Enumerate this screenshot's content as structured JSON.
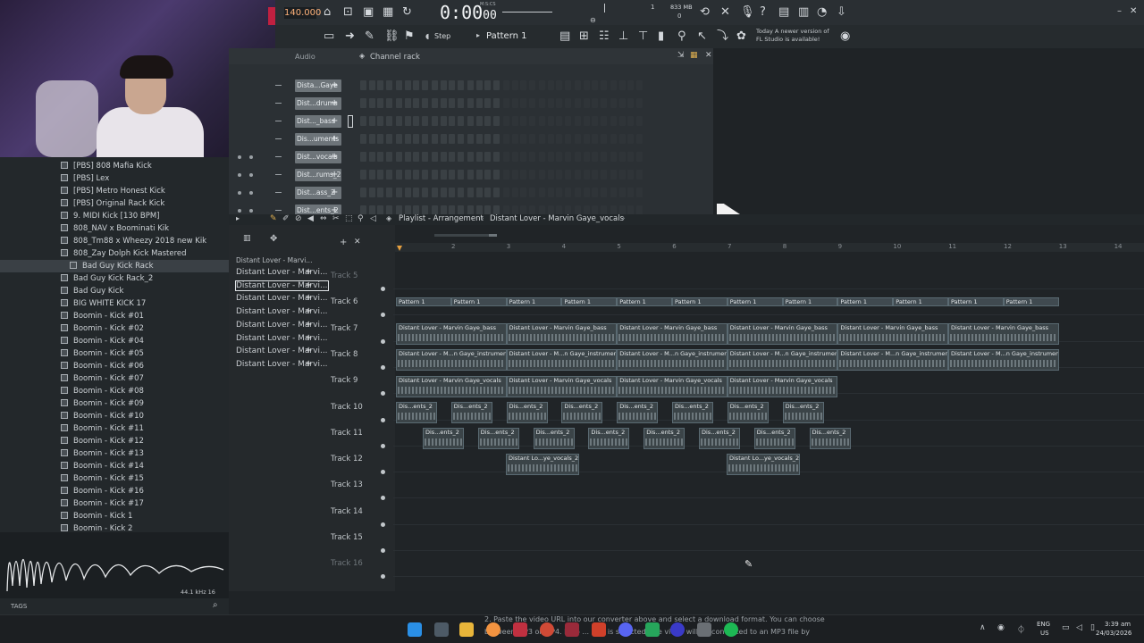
{
  "toolbar": {
    "tempo": "140.000",
    "time": "0:00",
    "time_sub": "00",
    "time_label": "M:S:CS",
    "cpu_label": "1",
    "memory": "833 MB",
    "memory_sub": "0",
    "pattern_name": "Pattern 1",
    "snap_mode": "Step",
    "news_line1": "Today  A newer version of",
    "news_line2": "FL Studio is available!"
  },
  "channel_rack": {
    "title": "Channel rack",
    "group": "Audio",
    "channels": [
      "Dista...Gaye",
      "Dist...drums",
      "Dist..._bass",
      "Dis...uments",
      "Dist...vocals",
      "Dist...rums_2",
      "Dist...ass_2",
      "Dist...ents_2"
    ]
  },
  "browser": {
    "items": [
      "[PBS] 808 Mafia Kick",
      "[PBS] Lex",
      "[PBS] Metro Honest Kick",
      "[PBS] Original Rack Kick",
      "9. MIDI Kick [130 BPM]",
      "808_NAV x Boominati Kik",
      "808_Tm88 x Wheezy 2018 new Kik",
      "808_Zay Dolph Kick Mastered",
      "Bad Guy Kick Rack",
      "Bad Guy Kick Rack_2",
      "Bad Guy Kick",
      "BIG WHITE KICK 17",
      "Boomin - Kick #01",
      "Boomin - Kick #02",
      "Boomin - Kick #04",
      "Boomin - Kick #05",
      "Boomin - Kick #06",
      "Boomin - Kick #07",
      "Boomin - Kick #08",
      "Boomin - Kick #09",
      "Boomin - Kick #10",
      "Boomin - Kick #11",
      "Boomin - Kick #12",
      "Boomin - Kick #13",
      "Boomin - Kick #14",
      "Boomin - Kick #15",
      "Boomin - Kick #16",
      "Boomin - Kick #17",
      "Boomin - Kick 1",
      "Boomin - Kick 2"
    ],
    "selected_index": 8,
    "sample_rate": "44.1 kHz 16",
    "tags_label": "TAGS"
  },
  "playlist": {
    "title": "Playlist - Arrangement",
    "clip_path": "Distant Lover - Marvin Gaye_vocals",
    "picker_header": "Distant Lover - Marvi...",
    "picker_items": [
      "Distant Lover - Marvi...",
      "Distant Lover - Marvi...",
      "Distant Lover - Marvi...",
      "Distant Lover - Marvi...",
      "Distant Lover - Marvi...",
      "Distant Lover - Marvi...",
      "Distant Lover - Marvi...",
      "Distant Lover - Marvi..."
    ],
    "ruler": [
      "2",
      "3",
      "4",
      "5",
      "6",
      "7",
      "8",
      "9",
      "10",
      "11",
      "12",
      "13",
      "14"
    ],
    "tracks": [
      "Track 5",
      "Track 6",
      "Track 7",
      "Track 8",
      "Track 9",
      "Track 10",
      "Track 11",
      "Track 12",
      "Track 13",
      "Track 14",
      "Track 15",
      "Track 16"
    ],
    "pattern_clip": "Pattern 1",
    "clip_bass": "Distant Lover - Marvin Gaye_bass",
    "clip_instruments": "Distant Lover - M...n Gaye_instruments",
    "clip_vocals": "Distant Lover - Marvin Gaye_vocals",
    "clip_ents2": "Dis...ents_2",
    "clip_vocals2": "Distant Lo...ye_vocals_2"
  },
  "taskbar": {
    "notification": "2. Paste the video URL into our converter above and select a download format. You can choose",
    "notification2": "between MP3 or MP4. If no ... mat is selected, the video will be converted to an MP3 file by",
    "lang": "ENG",
    "region": "US",
    "clock_time": "3:39 am",
    "clock_date": "24/03/2026"
  }
}
